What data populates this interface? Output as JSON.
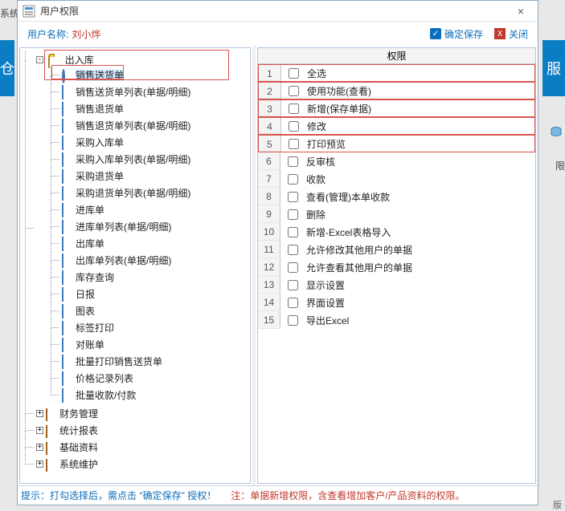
{
  "bg": {
    "left_text": "系统\nS)",
    "blue_left": "仓",
    "blue_right": "服",
    "bottom_cut": "版",
    "right_frag": "限  "
  },
  "window": {
    "title": "用户权限",
    "close_x": "×",
    "toolbar": {
      "user_label": "用户名称:",
      "user_name": "刘小烨",
      "save": "确定保存",
      "close": "关闭"
    },
    "footer": {
      "hint": "提示：打勾选择后，需点击 \"确定保存\" 授权！",
      "note": "注：单据新增权限，含查看增加客户/产品资料的权限。"
    }
  },
  "tree": {
    "root": "出入库",
    "children": [
      "销售送货单",
      "销售送货单列表(单据/明细)",
      "销售退货单",
      "销售退货单列表(单据/明细)",
      "采购入库单",
      "采购入库单列表(单据/明细)",
      "采购退货单",
      "采购退货单列表(单据/明细)",
      "进库单",
      "进库单列表(单据/明细)",
      "出库单",
      "出库单列表(单据/明细)",
      "库存查询",
      "日报",
      "图表",
      "标签打印",
      "对账单",
      "批量打印销售送货单",
      "价格记录列表",
      "批量收款/付款"
    ],
    "modules": [
      "财务管理",
      "统计报表",
      "基础资料",
      "系统维护"
    ],
    "toggle_minus": "-",
    "toggle_plus": "+"
  },
  "perm": {
    "header": "权限",
    "items": [
      "全选",
      "使用功能(查看)",
      "新增(保存单据)",
      "修改",
      "打印预览",
      "反审核",
      "收款",
      "查看(管理)本单收款",
      "删除",
      "新增-Excel表格导入",
      "允许修改其他用户的单据",
      "允许查看其他用户的单据",
      "显示设置",
      "界面设置",
      "导出Excel"
    ]
  }
}
